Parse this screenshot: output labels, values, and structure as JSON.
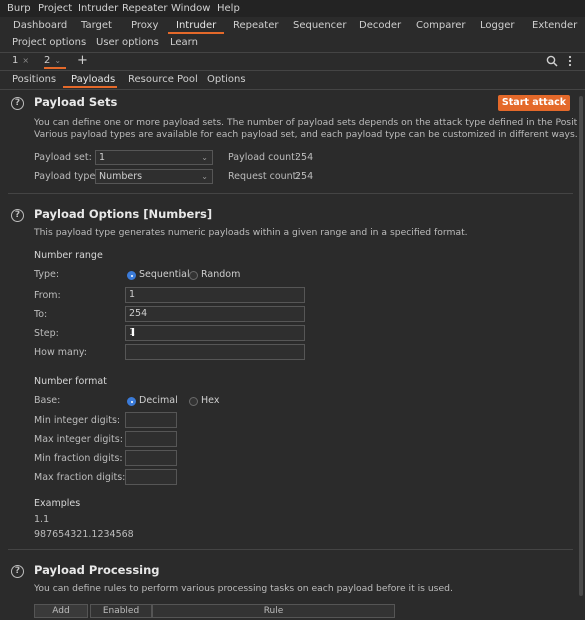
{
  "menubar": {
    "items": [
      "Burp",
      "Project",
      "Intruder",
      "Repeater",
      "Window",
      "Help"
    ]
  },
  "main_tabs": {
    "row1": [
      "Dashboard",
      "Target",
      "Proxy",
      "Intruder",
      "Repeater",
      "Sequencer",
      "Decoder",
      "Comparer",
      "Logger",
      "Extender"
    ],
    "row2": [
      "Project options",
      "User options",
      "Learn"
    ],
    "active": "Intruder"
  },
  "attack_tabs": {
    "tab1": "1",
    "tab2": "2",
    "close_glyph": "×",
    "dropdown_glyph": "⌄",
    "add_glyph": "+",
    "search_icon": "search-icon",
    "more_icon": "more-vertical-icon"
  },
  "intruder_tabs": {
    "items": [
      "Positions",
      "Payloads",
      "Resource Pool",
      "Options"
    ],
    "active": "Payloads"
  },
  "payload_sets": {
    "help_glyph": "?",
    "title": "Payload Sets",
    "start_attack": "Start attack",
    "desc_line1": "You can define one or more payload sets. The number of payload sets depends on the attack type defined in the Positions tab.",
    "desc_line2": "Various payload types are available for each payload set, and each payload type can be customized in different ways.",
    "payload_set_label": "Payload set:",
    "payload_set_value": "1",
    "payload_type_label": "Payload type:",
    "payload_type_value": "Numbers",
    "payload_count_label": "Payload count:",
    "payload_count_value": "254",
    "request_count_label": "Request count:",
    "request_count_value": "254"
  },
  "payload_options": {
    "help_glyph": "?",
    "title": "Payload Options [Numbers]",
    "desc": "This payload type generates numeric payloads within a given range and in a specified format.",
    "number_range": "Number range",
    "type_label": "Type:",
    "type_sequential": "Sequential",
    "type_random": "Random",
    "type_selected": "Sequential",
    "from_label": "From:",
    "from_value": "1",
    "to_label": "To:",
    "to_value": "254",
    "step_label": "Step:",
    "step_value": "1",
    "how_many_label": "How many:",
    "how_many_value": "",
    "number_format": "Number format",
    "base_label": "Base:",
    "base_decimal": "Decimal",
    "base_hex": "Hex",
    "base_selected": "Decimal",
    "min_int_label": "Min integer digits:",
    "max_int_label": "Max integer digits:",
    "min_frac_label": "Min fraction digits:",
    "max_frac_label": "Max fraction digits:",
    "examples_label": "Examples",
    "example1": "1.1",
    "example2": "987654321.1234568"
  },
  "payload_processing": {
    "help_glyph": "?",
    "title": "Payload Processing",
    "desc": "You can define rules to perform various processing tasks on each payload before it is used.",
    "add_button": "Add",
    "col_enabled": "Enabled",
    "col_rule": "Rule"
  },
  "colors": {
    "accent": "#e4692a",
    "background": "#2b2b2b",
    "radio_selected": "#3b7bd8"
  }
}
